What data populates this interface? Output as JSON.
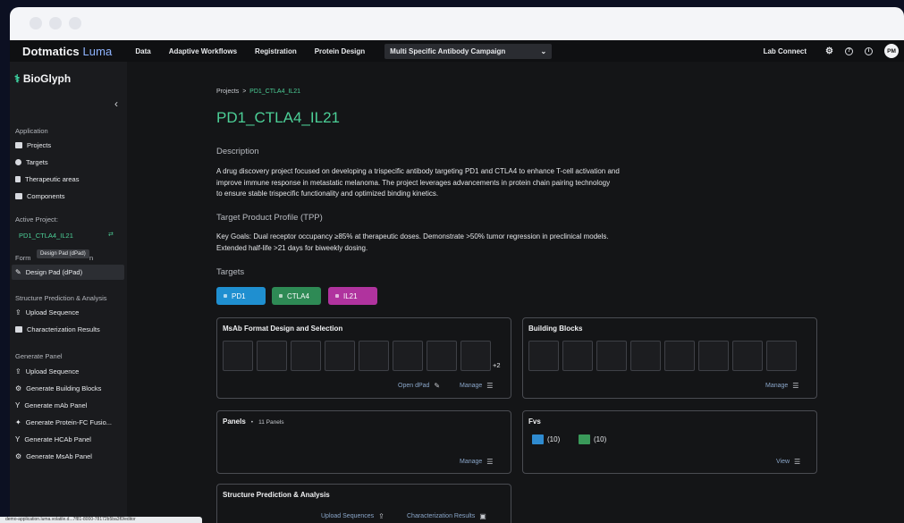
{
  "nav": {
    "logo_a": "Dotmatics",
    "logo_b": "Luma",
    "links": [
      "Data",
      "Adaptive Workflows",
      "Registration",
      "Protein Design"
    ],
    "select_value": "Multi Specific Antibody Campaign",
    "lab_connect": "Lab Connect",
    "avatar": "PM"
  },
  "sidebar": {
    "brand": "BioGlyph",
    "application_label": "Application",
    "application_items": [
      "Projects",
      "Targets",
      "Therapeutic areas",
      "Components"
    ],
    "active_project_label": "Active Project:",
    "active_project": "PD1_CTLA4_IL21",
    "formats_label": "Form",
    "formats_label_tail": "n",
    "tooltip": "Design Pad (dPad)",
    "design_pad": "Design Pad (dPad)",
    "structure_label": "Structure Prediction & Analysis",
    "structure_items": [
      "Upload Sequence",
      "Characterization Results"
    ],
    "generate_label": "Generate Panel",
    "generate_items": [
      "Upload Sequence",
      "Generate Building Blocks",
      "Generate mAb Panel",
      "Generate Protein-FC Fusio...",
      "Generate HCAb Panel",
      "Generate MsAb Panel"
    ]
  },
  "main": {
    "breadcrumb_root": "Projects",
    "breadcrumb_sep": ">",
    "breadcrumb_current": "PD1_CTLA4_IL21",
    "title": "PD1_CTLA4_IL21",
    "description_label": "Description",
    "description_lines": [
      "A drug discovery project focused on developing a trispecific antibody targeting PD1 and CTLA4 to enhance T-cell activation and",
      "improve immune response in metastatic melanoma. The project leverages advancements in protein chain pairing technology",
      "to ensure stable trispecific functionality and optimized binding kinetics."
    ],
    "tpp_label": "Target Product Profile (TPP)",
    "tpp_lines": [
      "Key Goals: Dual receptor occupancy ≥85% at therapeutic doses. Demonstrate >50% tumor regression in preclinical models.",
      "Extended half-life >21 days for biweekly dosing."
    ],
    "targets_label": "Targets",
    "targets": [
      {
        "label": "PD1",
        "color": "#1f8fd0"
      },
      {
        "label": "CTLA4",
        "color": "#2e8a55"
      },
      {
        "label": "IL21",
        "color": "#b0339e"
      }
    ],
    "cards": {
      "msab": {
        "title": "MsAb Format Design and Selection",
        "more": "+2",
        "open": "Open dPad",
        "manage": "Manage"
      },
      "blocks": {
        "title": "Building Blocks",
        "manage": "Manage"
      },
      "panels": {
        "title": "Panels",
        "bullet": "•",
        "count": "11 Panels",
        "manage": "Manage"
      },
      "fvs": {
        "title": "Fvs",
        "a": "(10)",
        "b": "(10)",
        "view": "View"
      },
      "structure": {
        "title": "Structure Prediction & Analysis",
        "upload": "Upload Sequences",
        "results": "Characterization Results"
      }
    }
  },
  "status_url": "demo-application.luma.volatile.d...7f81-8000-78172b5ba3f0/editor"
}
